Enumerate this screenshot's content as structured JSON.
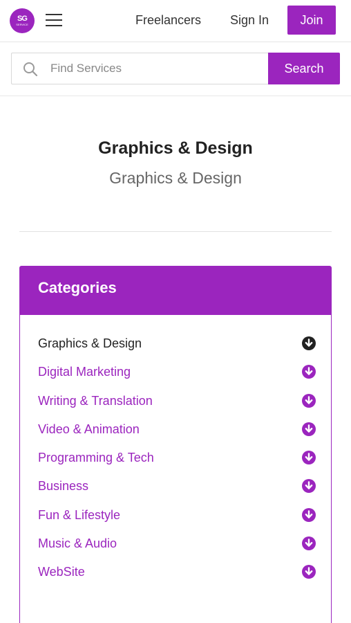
{
  "header": {
    "logo_text": "SG",
    "logo_subtext": "SERVICE",
    "nav": {
      "freelancers": "Freelancers",
      "sign_in": "Sign In",
      "join": "Join"
    }
  },
  "search": {
    "placeholder": "Find Services",
    "value": "",
    "button_label": "Search"
  },
  "page": {
    "title": "Graphics & Design",
    "subtitle": "Graphics & Design"
  },
  "categories": {
    "heading": "Categories",
    "items": [
      {
        "label": "Graphics & Design",
        "active": true
      },
      {
        "label": "Digital Marketing",
        "active": false
      },
      {
        "label": "Writing & Translation",
        "active": false
      },
      {
        "label": "Video & Animation",
        "active": false
      },
      {
        "label": "Programming & Tech",
        "active": false
      },
      {
        "label": "Business",
        "active": false
      },
      {
        "label": "Fun & Lifestyle",
        "active": false
      },
      {
        "label": "Music & Audio",
        "active": false
      },
      {
        "label": "WebSite",
        "active": false
      }
    ]
  },
  "colors": {
    "brand": "#9b25be",
    "active_text": "#222222",
    "active_icon": "#222222"
  }
}
